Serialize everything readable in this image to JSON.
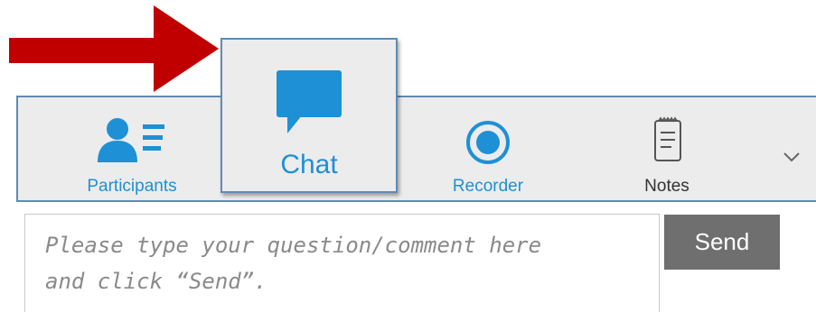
{
  "toolbar": {
    "tabs": [
      {
        "label": "Participants",
        "icon": "participants-icon"
      },
      {
        "label": "Chat",
        "icon": "chat-bubble-icon",
        "selected": true
      },
      {
        "label": "Recorder",
        "icon": "record-icon"
      },
      {
        "label": "Notes",
        "icon": "notepad-icon"
      }
    ],
    "more_icon": "chevron-down-icon"
  },
  "chat": {
    "placeholder_line1": "Please type your question/comment here",
    "placeholder_line2": "and click “Send”.",
    "send_label": "Send"
  },
  "colors": {
    "accent": "#1e90d6",
    "border": "#5e8bb5",
    "toolbar_bg": "#ececec",
    "arrow": "#c00000",
    "send_button": "#6f6f6f"
  }
}
